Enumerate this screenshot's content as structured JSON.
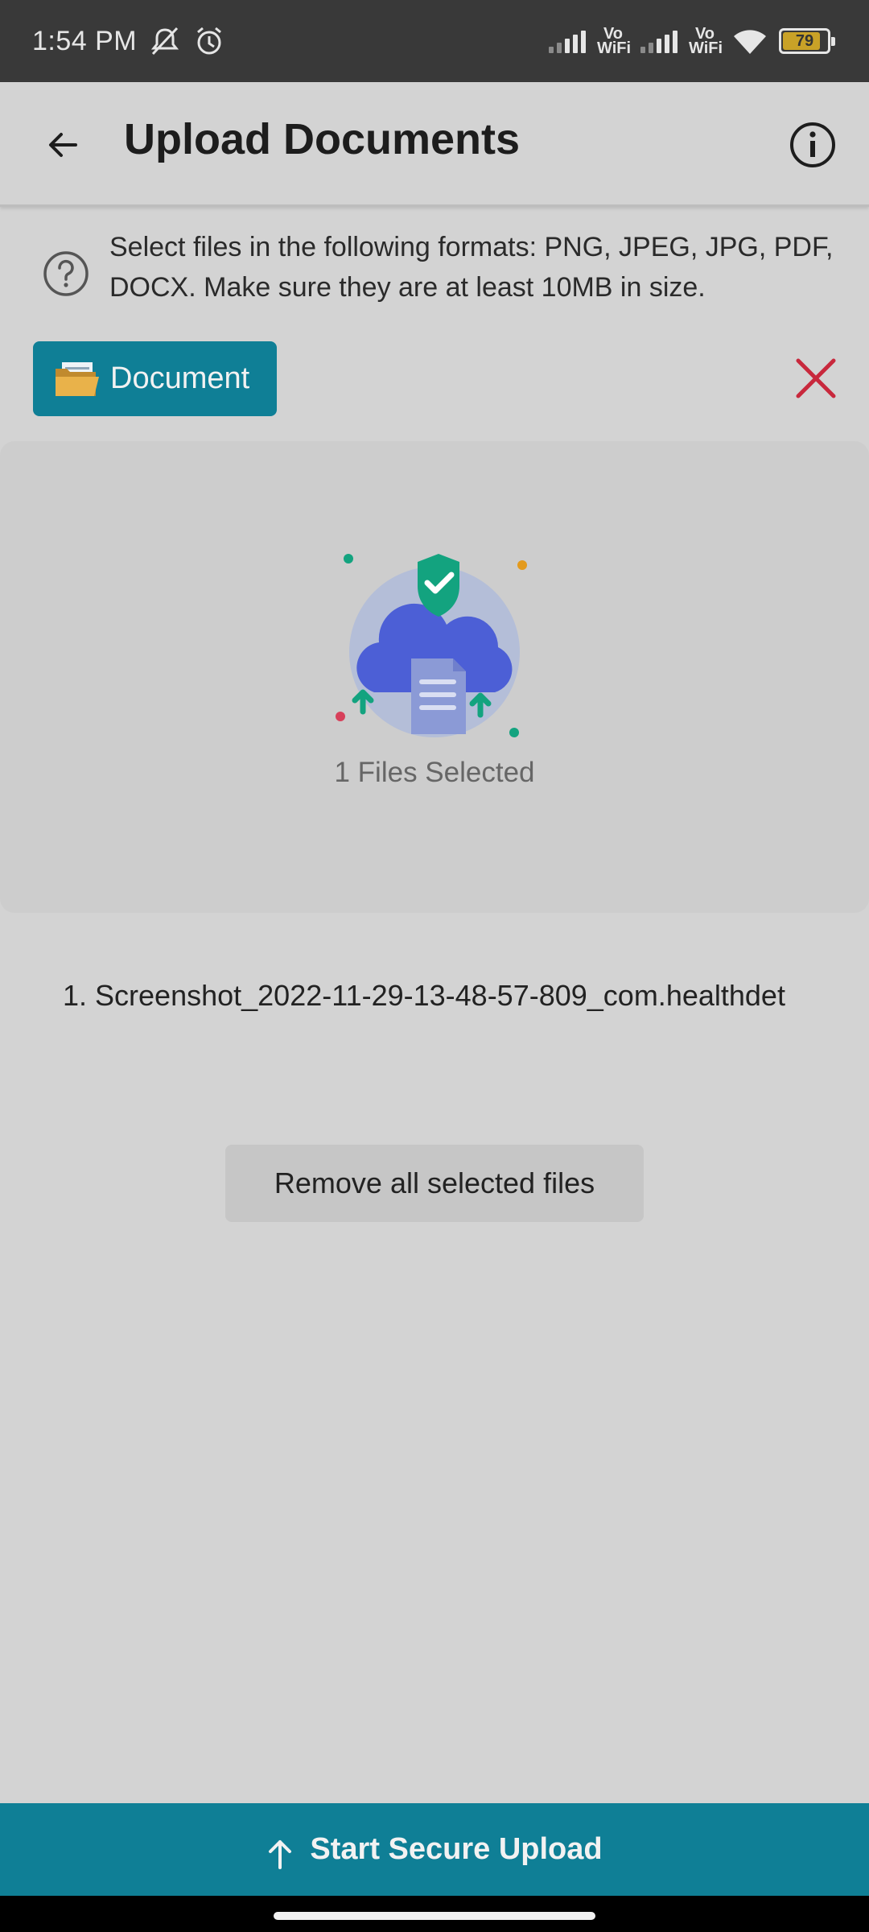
{
  "status_bar": {
    "time": "1:54 PM",
    "network_label_1": "Vo WiFi",
    "network_label_2": "Vo WiFi",
    "battery_level": "79",
    "icons": [
      "mute-icon",
      "alarm-icon",
      "signal-icon",
      "wifi-icon",
      "battery-icon"
    ]
  },
  "header": {
    "title": "Upload Documents",
    "back_icon": "arrow-left-icon",
    "info_icon": "info-icon"
  },
  "instructions": {
    "icon": "help-circle-icon",
    "text": "Select files in the following formats: PNG, JPEG, JPG, PDF, DOCX. Make sure they are at least 10MB in size."
  },
  "document_button": {
    "label": "Document",
    "icon": "folder-icon"
  },
  "clear_icon": "close-icon",
  "drop_zone": {
    "illustration": "cloud-upload-shield-icon",
    "status_text": "1 Files Selected"
  },
  "files": [
    "1. Screenshot_2022-11-29-13-48-57-809_com.healthdet"
  ],
  "remove_all_label": "Remove all selected files",
  "upload_button": {
    "label": "Start Secure Upload",
    "icon": "arrow-up-icon"
  },
  "colors": {
    "accent": "#0f7f96",
    "background": "#d3d3d3",
    "close": "#c8283c",
    "shield": "#13a37f",
    "cloud": "#4c5fd6"
  }
}
